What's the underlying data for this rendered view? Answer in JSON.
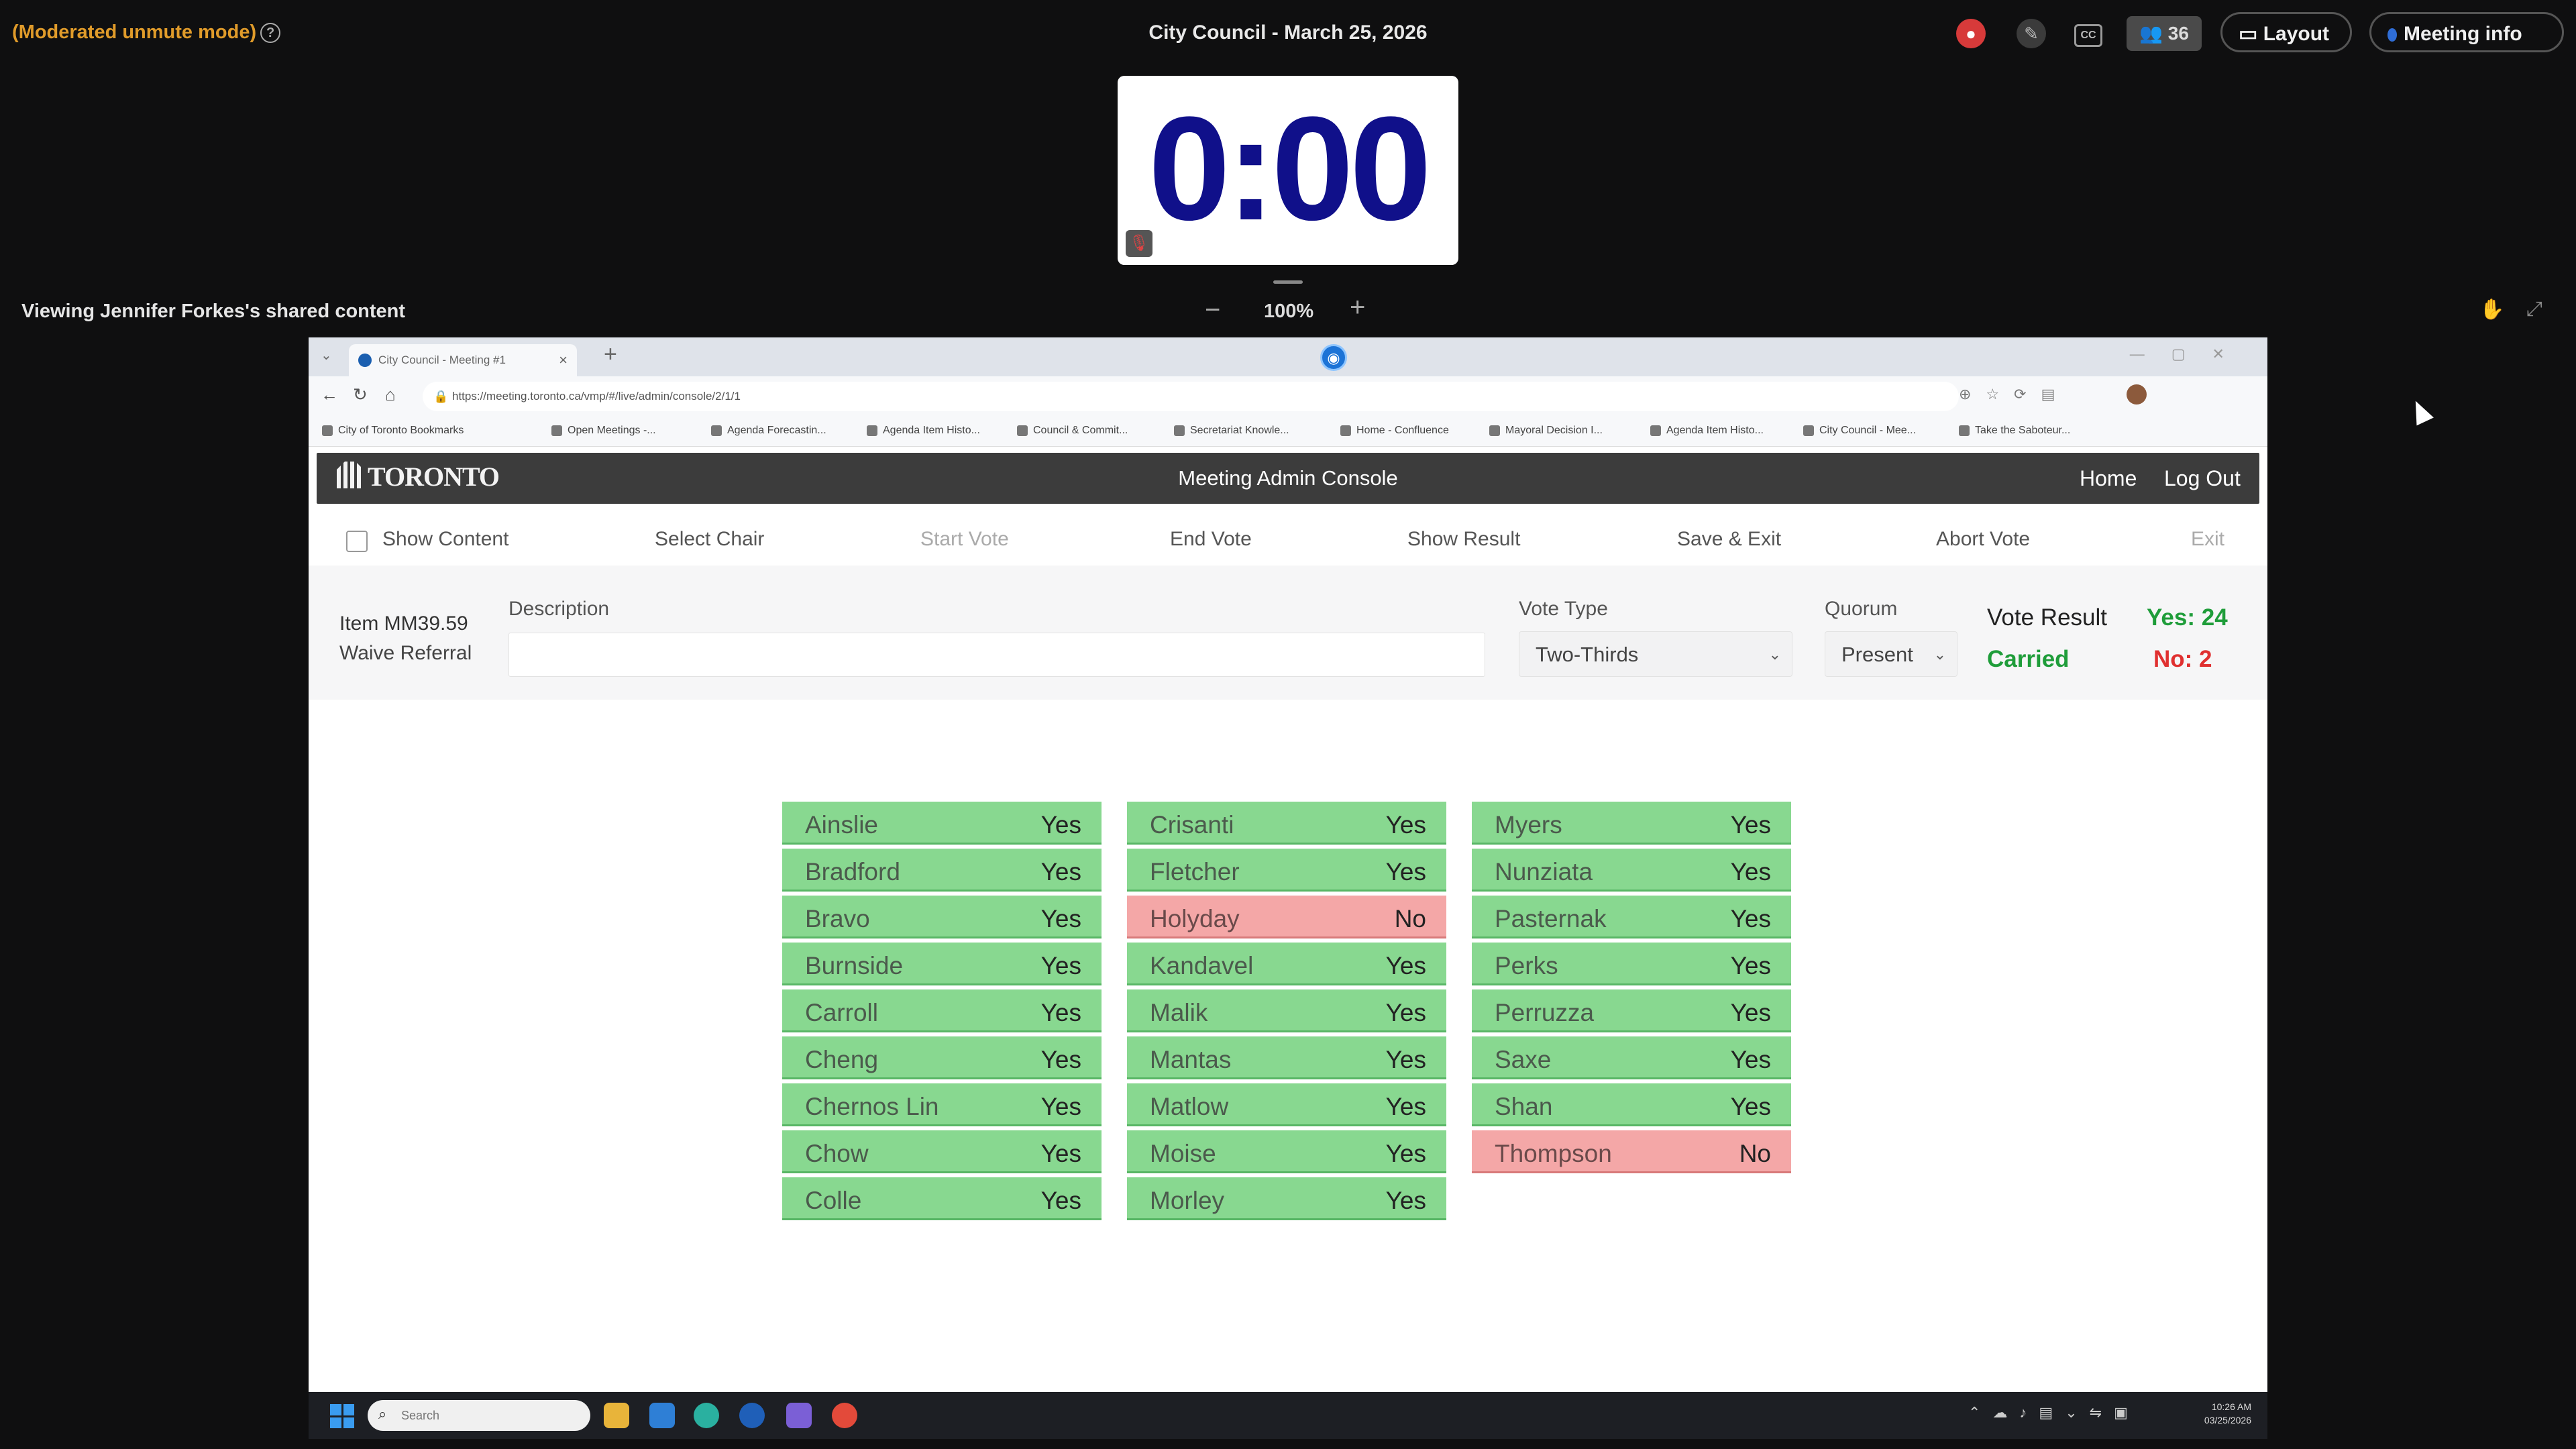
{
  "meeting": {
    "mode_label": "(Moderated unmute mode)",
    "title": "City Council - March 25, 2026",
    "participants_count": "36",
    "layout_label": "Layout",
    "info_label": "Meeting info",
    "timer": "0:00",
    "viewing_label": "Viewing Jennifer Forkes's shared content",
    "zoom_level": "100%"
  },
  "browser": {
    "tab_title": "City Council - Meeting #1",
    "url": "https://meeting.toronto.ca/vmp/#/live/admin/console/2/1/1",
    "bookmarks": [
      "City of Toronto Bookmarks",
      "Open Meetings -...",
      "Agenda Forecastin...",
      "Agenda Item Histo...",
      "Council & Commit...",
      "Secretariat Knowle...",
      "Home - Confluence",
      "Mayoral Decision I...",
      "Agenda Item Histo...",
      "City Council - Mee...",
      "Take the Saboteur..."
    ]
  },
  "app": {
    "logo_text": "TORONTO",
    "title": "Meeting Admin Console",
    "home_link": "Home",
    "logout_link": "Log Out",
    "toolbar": {
      "show_content": "Show Content",
      "select_chair": "Select Chair",
      "start_vote": "Start Vote",
      "end_vote": "End Vote",
      "show_result": "Show Result",
      "save_exit": "Save & Exit",
      "abort_vote": "Abort Vote",
      "exit": "Exit"
    },
    "item": {
      "id": "Item MM39.59",
      "motion": "Waive Referral",
      "description_label": "Description",
      "description_value": "",
      "vote_type_label": "Vote Type",
      "vote_type_value": "Two-Thirds",
      "quorum_label": "Quorum",
      "quorum_value": "Present",
      "result_label": "Vote Result",
      "result_status": "Carried",
      "yes_count": "Yes: 24",
      "no_count": "No: 2"
    },
    "votes": {
      "col1": [
        {
          "name": "Ainslie",
          "vote": "Yes"
        },
        {
          "name": "Bradford",
          "vote": "Yes"
        },
        {
          "name": "Bravo",
          "vote": "Yes"
        },
        {
          "name": "Burnside",
          "vote": "Yes"
        },
        {
          "name": "Carroll",
          "vote": "Yes"
        },
        {
          "name": "Cheng",
          "vote": "Yes"
        },
        {
          "name": "Chernos Lin",
          "vote": "Yes"
        },
        {
          "name": "Chow",
          "vote": "Yes"
        },
        {
          "name": "Colle",
          "vote": "Yes"
        }
      ],
      "col2": [
        {
          "name": "Crisanti",
          "vote": "Yes"
        },
        {
          "name": "Fletcher",
          "vote": "Yes"
        },
        {
          "name": "Holyday",
          "vote": "No"
        },
        {
          "name": "Kandavel",
          "vote": "Yes"
        },
        {
          "name": "Malik",
          "vote": "Yes"
        },
        {
          "name": "Mantas",
          "vote": "Yes"
        },
        {
          "name": "Matlow",
          "vote": "Yes"
        },
        {
          "name": "Moise",
          "vote": "Yes"
        },
        {
          "name": "Morley",
          "vote": "Yes"
        }
      ],
      "col3": [
        {
          "name": "Myers",
          "vote": "Yes"
        },
        {
          "name": "Nunziata",
          "vote": "Yes"
        },
        {
          "name": "Pasternak",
          "vote": "Yes"
        },
        {
          "name": "Perks",
          "vote": "Yes"
        },
        {
          "name": "Perruzza",
          "vote": "Yes"
        },
        {
          "name": "Saxe",
          "vote": "Yes"
        },
        {
          "name": "Shan",
          "vote": "Yes"
        },
        {
          "name": "Thompson",
          "vote": "No"
        }
      ]
    }
  },
  "taskbar": {
    "search_placeholder": "Search",
    "time": "10:26 AM",
    "date": "03/25/2026"
  },
  "colors": {
    "yes_bg": "#88d890",
    "no_bg": "#f4a7a7",
    "carried": "#1f9d3a",
    "no_text": "#e03030",
    "timer": "#10108a"
  }
}
